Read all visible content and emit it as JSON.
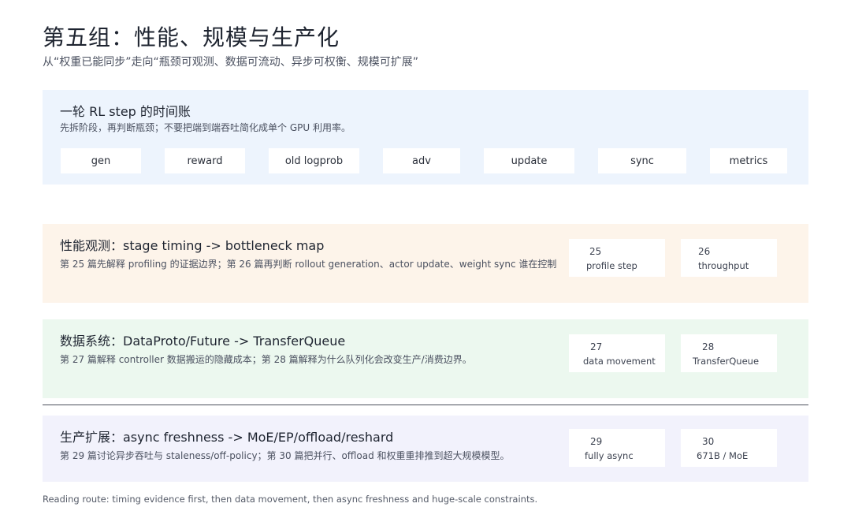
{
  "header": {
    "title": "第五组：性能、规模与生产化",
    "subtitle": "从“权重已能同步”走向“瓶颈可观测、数据可流动、异步可权衡、规模可扩展”"
  },
  "timing_panel": {
    "title": "一轮 RL step 的时间账",
    "desc": "先拆阶段，再判断瓶颈；不要把端到端吞吐简化成单个 GPU 利用率。",
    "stages": [
      "gen",
      "reward",
      "old logprob",
      "adv",
      "update",
      "sync",
      "metrics"
    ]
  },
  "sections": [
    {
      "title": "性能观测：stage timing -> bottleneck map",
      "desc": "第 25 篇先解释 profiling 的证据边界；第 26 篇再判断 rollout generation、actor update、weight sync 谁在控制",
      "cards": [
        {
          "num": "25",
          "label": "profile step"
        },
        {
          "num": "26",
          "label": "throughput"
        }
      ]
    },
    {
      "title": "数据系统：DataProto/Future -> TransferQueue",
      "desc": "第 27 篇解释 controller 数据搬运的隐藏成本；第 28 篇解释为什么队列化会改变生产/消费边界。",
      "cards": [
        {
          "num": "27",
          "label": "data movement"
        },
        {
          "num": "28",
          "label": "TransferQueue"
        }
      ]
    },
    {
      "title": "生产扩展：async freshness -> MoE/EP/offload/reshard",
      "desc": "第 29 篇讨论异步吞吐与 staleness/off-policy；第 30 篇把并行、offload 和权重重排推到超大规模模型。",
      "cards": [
        {
          "num": "29",
          "label": "fully async"
        },
        {
          "num": "30",
          "label": "671B / MoE"
        }
      ]
    }
  ],
  "footer": "Reading route: timing evidence first, then data movement, then async freshness and huge-scale constraints."
}
